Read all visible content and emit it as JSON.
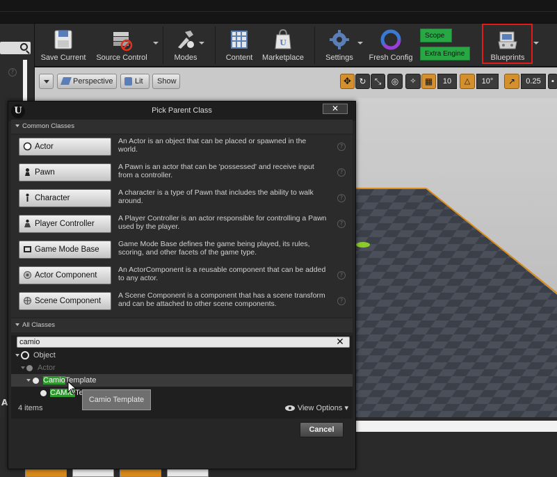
{
  "toolbar": {
    "save_current": "Save Current",
    "source_control": "Source Control",
    "modes": "Modes",
    "content": "Content",
    "marketplace": "Marketplace",
    "settings": "Settings",
    "fresh_config": "Fresh Config",
    "green_top": "Scope",
    "green_bottom": "Extra Engine",
    "blueprints": "Blueprints"
  },
  "viewport": {
    "perspective": "Perspective",
    "lit": "Lit",
    "show": "Show",
    "grid_snap": "10",
    "rotation_snap": "10°",
    "scale_snap": "0.25"
  },
  "dialog": {
    "title": "Pick Parent Class",
    "close": "✕",
    "common_header": "Common Classes",
    "common_classes": [
      {
        "label": "Actor",
        "desc": "An Actor is an object that can be placed or spawned in the world.",
        "icon": "actor-icon"
      },
      {
        "label": "Pawn",
        "desc": "A Pawn is an actor that can be 'possessed' and receive input from a controller.",
        "icon": "pawn-icon"
      },
      {
        "label": "Character",
        "desc": "A character is a type of Pawn that includes the ability to walk around.",
        "icon": "character-icon"
      },
      {
        "label": "Player Controller",
        "desc": "A Player Controller is an actor responsible for controlling a Pawn used by the player.",
        "icon": "player-controller-icon"
      },
      {
        "label": "Game Mode Base",
        "desc": "Game Mode Base defines the game being played, its rules, scoring, and other facets of the game type.",
        "icon": "game-mode-icon"
      },
      {
        "label": "Actor Component",
        "desc": "An ActorComponent is a reusable component that can be added to any actor.",
        "icon": "actor-component-icon"
      },
      {
        "label": "Scene Component",
        "desc": "A Scene Component is a component that has a scene transform and can be attached to other scene components.",
        "icon": "scene-component-icon"
      }
    ],
    "all_header": "All Classes",
    "search_value": "camio",
    "tree": {
      "object": "Object",
      "actor": "Actor",
      "template_match": "Camio",
      "template_rest": "Template",
      "text_match": "CAMIO",
      "text_rest": "Text"
    },
    "item_count": "4 items",
    "view_options": "View Options",
    "tooltip": "Camio Template",
    "cancel": "Cancel"
  }
}
